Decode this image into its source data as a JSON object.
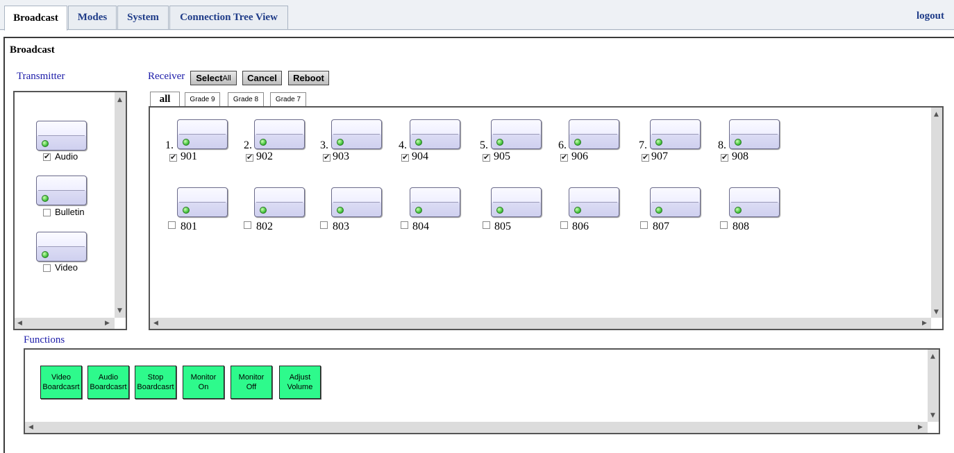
{
  "nav": {
    "tabs": [
      {
        "label": "Broadcast",
        "active": true
      },
      {
        "label": "Modes"
      },
      {
        "label": "System"
      },
      {
        "label": "Connection Tree View"
      }
    ],
    "logout": "logout"
  },
  "page": {
    "title": "Broadcast"
  },
  "transmitter": {
    "label": "Transmitter",
    "devices": [
      {
        "name": "Audio",
        "checked": true
      },
      {
        "name": "Bulletin",
        "checked": false
      },
      {
        "name": "Video",
        "checked": false
      }
    ]
  },
  "receiver": {
    "label": "Receiver",
    "buttons": {
      "select": "Select ",
      "select_small": "All",
      "cancel": "Cancel",
      "reboot": "Reboot"
    },
    "group_tabs": [
      "all",
      "Grade 9",
      "Grade 8",
      "Grade 7"
    ],
    "rows": [
      [
        {
          "num": "1.",
          "name": "901",
          "checked": true
        },
        {
          "num": "2.",
          "name": "902",
          "checked": true
        },
        {
          "num": "3.",
          "name": "903",
          "checked": true
        },
        {
          "num": "4.",
          "name": "904",
          "checked": true
        },
        {
          "num": "5.",
          "name": "905",
          "checked": true
        },
        {
          "num": "6.",
          "name": "906",
          "checked": true
        },
        {
          "num": "7.",
          "name": "907",
          "checked": true
        },
        {
          "num": "8.",
          "name": "908",
          "checked": true
        }
      ],
      [
        {
          "name": "801",
          "checked": false
        },
        {
          "name": "802",
          "checked": false
        },
        {
          "name": "803",
          "checked": false
        },
        {
          "name": "804",
          "checked": false
        },
        {
          "name": "805",
          "checked": false
        },
        {
          "name": "806",
          "checked": false
        },
        {
          "name": "807",
          "checked": false
        },
        {
          "name": "808",
          "checked": false
        }
      ]
    ]
  },
  "functions": {
    "label": "Functions",
    "buttons": [
      {
        "line1": "Video",
        "line2": "Boardcasrt"
      },
      {
        "line1": "Audio",
        "line2": "Boardcasrt"
      },
      {
        "line1": "Stop",
        "line2": "Boardcasrt"
      },
      {
        "line1": "Monitor",
        "line2": "On"
      },
      {
        "line1": "Monitor",
        "line2": "Off"
      },
      {
        "line1": "Adjust",
        "line2": "Volume"
      }
    ]
  },
  "icons": {
    "scroll_up": "▲",
    "scroll_down": "▼",
    "scroll_left": "◀",
    "scroll_right": "▶"
  },
  "colors": {
    "function_button": "#2efa8c",
    "led": "#3fc03a",
    "section_label": "#1a1aa8",
    "nav_link": "#1f3c88"
  }
}
